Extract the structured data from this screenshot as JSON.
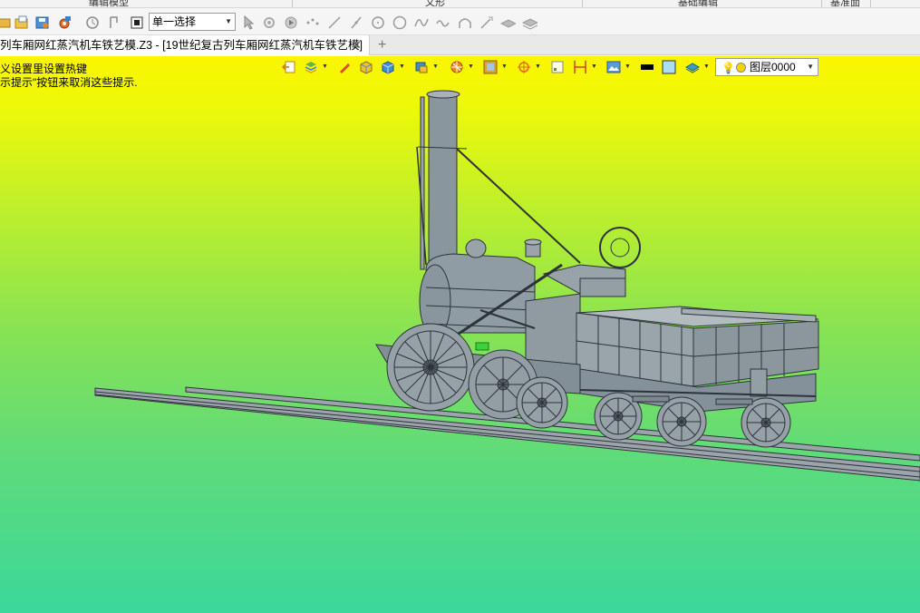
{
  "ribbon": {
    "groups": [
      "编辑模型",
      "文形",
      "基础编辑",
      "基准面"
    ]
  },
  "toolbar": {
    "selection_filter": "单一选择"
  },
  "tabs": {
    "doc_title": "列车厢网红蒸汽机车铁艺模.Z3 - [19世纪复古列车厢网红蒸汽机车铁艺模]",
    "close_glyph": "✕",
    "new_glyph": "+"
  },
  "viewport": {
    "hint_line1": "义设置里设置热键",
    "hint_line2": "示提示\"按钮来取消这些提示."
  },
  "layer": {
    "name": "图层0000"
  },
  "icons": {
    "toolbar": [
      "open-icon",
      "folder-icon",
      "save-icon",
      "gear-icon",
      "rotate-icon",
      "pick-icon",
      "stop-icon",
      "cursor-icon",
      "point-icon",
      "play-icon",
      "dots-icon",
      "line-icon",
      "slash-icon",
      "circle-icon",
      "circle2-icon",
      "curve-icon",
      "wave-icon",
      "arc-icon",
      "spline-icon",
      "eye-icon",
      "eye2-icon"
    ],
    "viewport": [
      "exit-icon",
      "layers-icon",
      "pen-icon",
      "cube-icon",
      "box-icon",
      "cube-view-icon",
      "sphere-icon",
      "frame-icon",
      "target-icon",
      "border-icon",
      "align-icon",
      "image-icon",
      "color-swatch-icon",
      "bg-swatch-icon",
      "stack-icon",
      "bulb-icon"
    ]
  },
  "colors": {
    "gradient_top": "#fbf600",
    "gradient_bottom": "#3bd89a",
    "model_body": "#8d9aa2",
    "model_line": "#2d3338"
  }
}
